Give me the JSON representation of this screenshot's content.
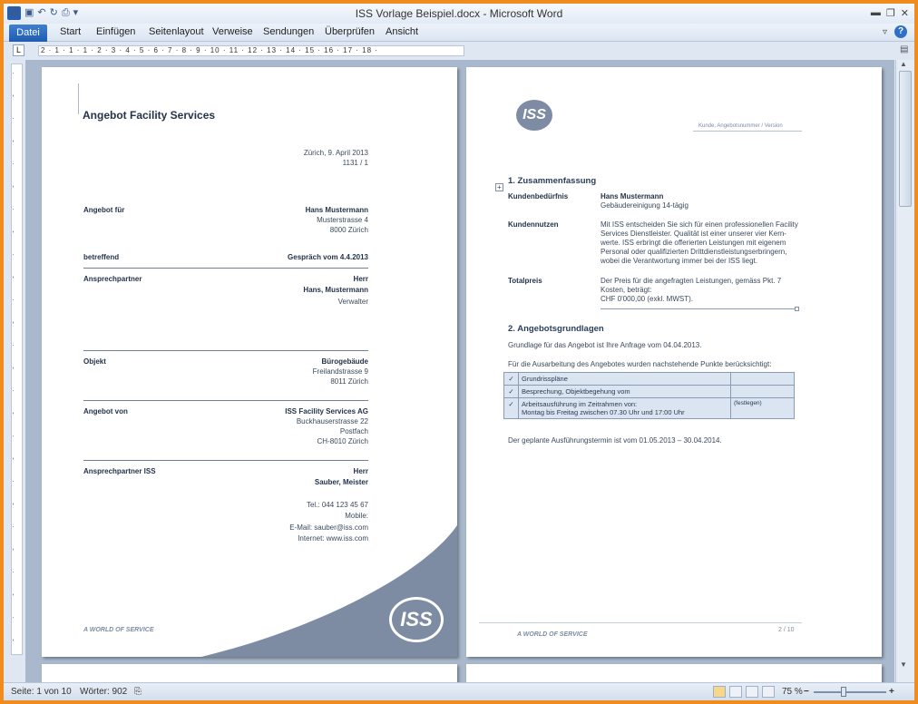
{
  "window": {
    "title": "ISS Vorlage Beispiel.docx - Microsoft Word",
    "app_icon": "W"
  },
  "ribbon": {
    "file_tab": "Datei",
    "tabs": [
      "Start",
      "Einfügen",
      "Seitenlayout",
      "Verweise",
      "Sendungen",
      "Überprüfen",
      "Ansicht"
    ]
  },
  "ruler": {
    "marks": "2 · 1 · 1 · 1 · 2 · 3 · 4 · 5 · 6 · 7 · 8 · 9 · 10 · 11 · 12 · 13 · 14 · 15 · 16 · 17 · 18 ·"
  },
  "page1": {
    "title": "Angebot Facility Services",
    "date": "Zürich, 9. April 2013",
    "number": "1131 / 1",
    "rows": [
      {
        "label": "Angebot für",
        "lines": [
          "Hans Mustermann",
          "Musterstrasse 4",
          "8000 Zürich"
        ]
      },
      {
        "label": "betreffend",
        "lines": [
          "Gespräch vom 4.4.2013"
        ]
      },
      {
        "label": "Ansprechpartner",
        "lines": [
          "Herr",
          "Hans, Mustermann",
          "Verwalter"
        ]
      },
      {
        "label": "Objekt",
        "lines": [
          "Bürogebäude",
          "Freilandstrasse 9",
          "8011 Zürich"
        ]
      },
      {
        "label": "Angebot von",
        "lines": [
          "ISS Facility Services AG",
          "Buckhauserstrasse 22",
          "Postfach",
          "CH-8010 Zürich"
        ]
      },
      {
        "label": "Ansprechpartner ISS",
        "lines": [
          "Herr",
          "Sauber, Meister"
        ]
      }
    ],
    "contact": [
      "Tel.: 044 123 45 67",
      "Mobile:",
      "E-Mail: sauber@iss.com",
      "Internet: www.iss.com"
    ],
    "footer": "A WORLD OF SERVICE",
    "logo": "ISS"
  },
  "page2": {
    "logo": "ISS",
    "header_right": "Kunde, Angebotsnummer / Version",
    "s1_title": "1.   Zusammenfassung",
    "s1_rows": [
      {
        "label": "Kundenbedürfnis",
        "lines": [
          "Hans Mustermann",
          "Gebäudereinigung 14-tägig"
        ]
      },
      {
        "label": "Kundennutzen",
        "lines": [
          "Mit ISS entscheiden Sie sich für einen professionellen Facility",
          "Services Dienstleister. Qualität ist einer unserer vier Kern-",
          "werte. ISS erbringt die offerierten Leistungen mit eigenem",
          "Personal oder qualifizierten Drittdienstleistungserbringern,",
          "wobei die Verantwortung immer bei der ISS liegt."
        ]
      },
      {
        "label": "Totalpreis",
        "lines": [
          "Der Preis für die angefragten Leistungen, gemäss Pkt. 7",
          "Kosten, beträgt:",
          "CHF 0'000,00 (exkl. MWST)."
        ]
      }
    ],
    "s2_title": "2.   Angebotsgrundlagen",
    "s2_p1": "Grundlage für das Angebot ist Ihre Anfrage vom 04.04.2013.",
    "s2_p2": "Für die Ausarbeitung des Angebotes wurden nachstehende Punkte berücksichtigt:",
    "table": [
      {
        "check": "✓",
        "text": "Grundrisspläne",
        "note": ""
      },
      {
        "check": "✓",
        "text": "Besprechung, Objektbegehung vom",
        "note": ""
      },
      {
        "check": "✓",
        "text": "Arbeitsausführung im Zeitrahmen von:\nMontag bis Freitag zwischen 07.30 Uhr und 17:00 Uhr",
        "note": "(festlegen)"
      }
    ],
    "s2_p3": "Der geplante Ausführungstermin ist vom 01.05.2013 – 30.04.2014.",
    "footer": "A WORLD OF SERVICE",
    "page_no": "2 / 10"
  },
  "status": {
    "page": "Seite: 1 von 10",
    "words": "Wörter: 902",
    "zoom": "75 %"
  },
  "colors": {
    "accent": "#2b5fae",
    "frame": "#f08c1e",
    "logo_bg": "#7d8ca3"
  }
}
